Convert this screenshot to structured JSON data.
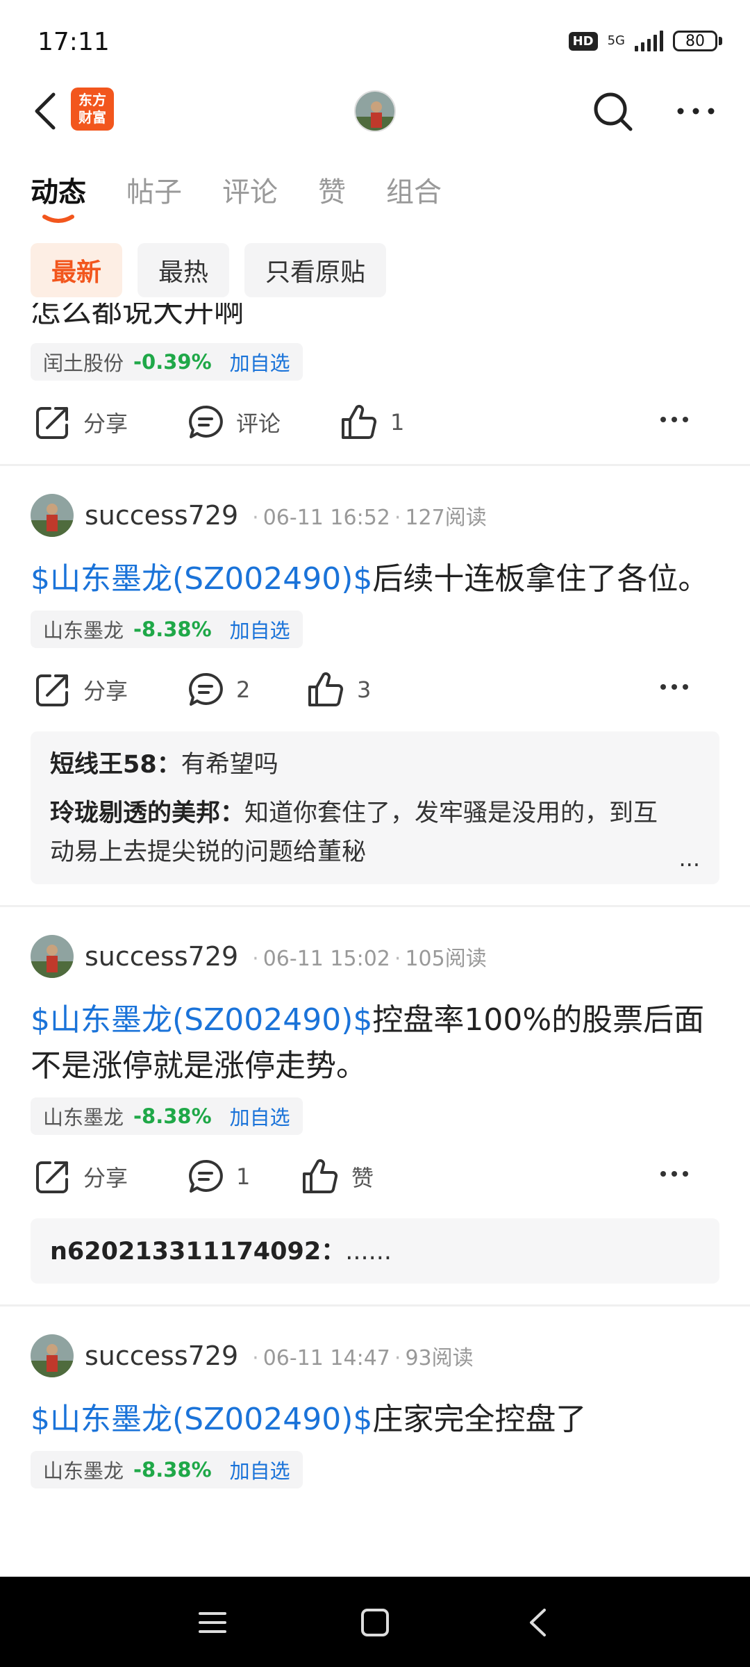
{
  "status_bar": {
    "time": "17:11",
    "hd": "HD",
    "network": "5G",
    "battery": "80"
  },
  "header": {
    "logo_text": "东方财富",
    "back_icon": "back-arrow-icon",
    "search_icon": "search-icon",
    "more_icon": "more-dots-icon"
  },
  "tabs": [
    {
      "label": "动态",
      "active": true
    },
    {
      "label": "帖子",
      "active": false
    },
    {
      "label": "评论",
      "active": false
    },
    {
      "label": "赞",
      "active": false
    },
    {
      "label": "组合",
      "active": false
    }
  ],
  "filters": [
    {
      "label": "最新",
      "active": true
    },
    {
      "label": "最热",
      "active": false
    },
    {
      "label": "只看原贴",
      "active": false
    }
  ],
  "colors": {
    "accent": "#f2561d",
    "link": "#1a73d9",
    "down": "#1fa848"
  },
  "posts": [
    {
      "text": "怎么都说大开啊",
      "stock": {
        "name": "闰土股份",
        "change": "-0.39%",
        "add_label": "加自选"
      },
      "actions": {
        "share": "分享",
        "comment": "评论",
        "like": "1"
      }
    },
    {
      "author": "success729",
      "time": "06-11 16:52",
      "reads": "127阅读",
      "ticker": "$山东墨龙(SZ002490)$",
      "text": "后续十连板拿住了各位。",
      "stock": {
        "name": "山东墨龙",
        "change": "-8.38%",
        "add_label": "加自选"
      },
      "actions": {
        "share": "分享",
        "comment": "2",
        "like": "3"
      },
      "comments": [
        {
          "user": "短线王58：",
          "text": "有希望吗"
        },
        {
          "user": "玲珑剔透的美邦：",
          "text": "知道你套住了，发牢骚是没用的，到互动易上去提尖锐的问题给董秘"
        }
      ],
      "comment_more": "..."
    },
    {
      "author": "success729",
      "time": "06-11 15:02",
      "reads": "105阅读",
      "ticker": "$山东墨龙(SZ002490)$",
      "text": "控盘率100%的股票后面不是涨停就是涨停走势。",
      "stock": {
        "name": "山东墨龙",
        "change": "-8.38%",
        "add_label": "加自选"
      },
      "actions": {
        "share": "分享",
        "comment": "1",
        "like": "赞"
      },
      "comments": [
        {
          "user": "n620213311174092：",
          "text": "......"
        }
      ]
    },
    {
      "author": "success729",
      "time": "06-11 14:47",
      "reads": "93阅读",
      "ticker": "$山东墨龙(SZ002490)$",
      "text": "庄家完全控盘了",
      "stock": {
        "name": "山东墨龙",
        "change": "-8.38%",
        "add_label": "加自选"
      }
    }
  ],
  "navbar": {
    "menu_icon": "menu-icon",
    "home_icon": "home-square-icon",
    "back_icon": "nav-back-icon"
  }
}
